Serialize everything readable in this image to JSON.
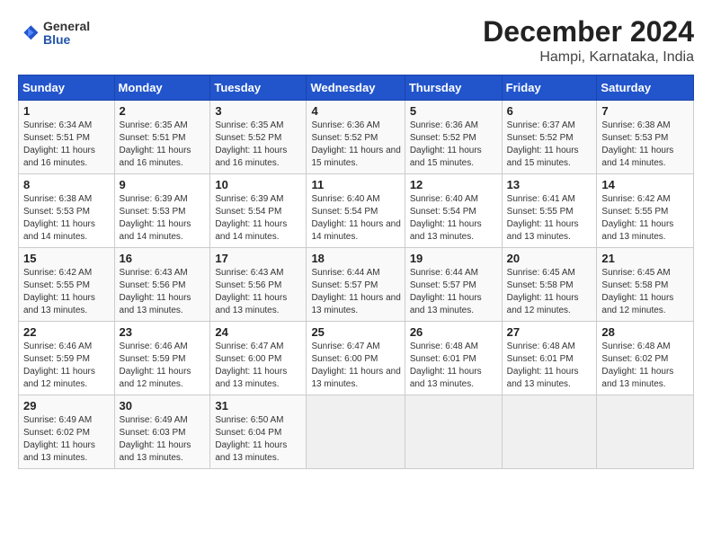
{
  "header": {
    "logo_general": "General",
    "logo_blue": "Blue",
    "month_title": "December 2024",
    "location": "Hampi, Karnataka, India"
  },
  "days_of_week": [
    "Sunday",
    "Monday",
    "Tuesday",
    "Wednesday",
    "Thursday",
    "Friday",
    "Saturday"
  ],
  "weeks": [
    [
      {
        "day": "1",
        "sunrise": "6:34 AM",
        "sunset": "5:51 PM",
        "daylight": "11 hours and 16 minutes."
      },
      {
        "day": "2",
        "sunrise": "6:35 AM",
        "sunset": "5:51 PM",
        "daylight": "11 hours and 16 minutes."
      },
      {
        "day": "3",
        "sunrise": "6:35 AM",
        "sunset": "5:52 PM",
        "daylight": "11 hours and 16 minutes."
      },
      {
        "day": "4",
        "sunrise": "6:36 AM",
        "sunset": "5:52 PM",
        "daylight": "11 hours and 15 minutes."
      },
      {
        "day": "5",
        "sunrise": "6:36 AM",
        "sunset": "5:52 PM",
        "daylight": "11 hours and 15 minutes."
      },
      {
        "day": "6",
        "sunrise": "6:37 AM",
        "sunset": "5:52 PM",
        "daylight": "11 hours and 15 minutes."
      },
      {
        "day": "7",
        "sunrise": "6:38 AM",
        "sunset": "5:53 PM",
        "daylight": "11 hours and 14 minutes."
      }
    ],
    [
      {
        "day": "8",
        "sunrise": "6:38 AM",
        "sunset": "5:53 PM",
        "daylight": "11 hours and 14 minutes."
      },
      {
        "day": "9",
        "sunrise": "6:39 AM",
        "sunset": "5:53 PM",
        "daylight": "11 hours and 14 minutes."
      },
      {
        "day": "10",
        "sunrise": "6:39 AM",
        "sunset": "5:54 PM",
        "daylight": "11 hours and 14 minutes."
      },
      {
        "day": "11",
        "sunrise": "6:40 AM",
        "sunset": "5:54 PM",
        "daylight": "11 hours and 14 minutes."
      },
      {
        "day": "12",
        "sunrise": "6:40 AM",
        "sunset": "5:54 PM",
        "daylight": "11 hours and 13 minutes."
      },
      {
        "day": "13",
        "sunrise": "6:41 AM",
        "sunset": "5:55 PM",
        "daylight": "11 hours and 13 minutes."
      },
      {
        "day": "14",
        "sunrise": "6:42 AM",
        "sunset": "5:55 PM",
        "daylight": "11 hours and 13 minutes."
      }
    ],
    [
      {
        "day": "15",
        "sunrise": "6:42 AM",
        "sunset": "5:55 PM",
        "daylight": "11 hours and 13 minutes."
      },
      {
        "day": "16",
        "sunrise": "6:43 AM",
        "sunset": "5:56 PM",
        "daylight": "11 hours and 13 minutes."
      },
      {
        "day": "17",
        "sunrise": "6:43 AM",
        "sunset": "5:56 PM",
        "daylight": "11 hours and 13 minutes."
      },
      {
        "day": "18",
        "sunrise": "6:44 AM",
        "sunset": "5:57 PM",
        "daylight": "11 hours and 13 minutes."
      },
      {
        "day": "19",
        "sunrise": "6:44 AM",
        "sunset": "5:57 PM",
        "daylight": "11 hours and 13 minutes."
      },
      {
        "day": "20",
        "sunrise": "6:45 AM",
        "sunset": "5:58 PM",
        "daylight": "11 hours and 12 minutes."
      },
      {
        "day": "21",
        "sunrise": "6:45 AM",
        "sunset": "5:58 PM",
        "daylight": "11 hours and 12 minutes."
      }
    ],
    [
      {
        "day": "22",
        "sunrise": "6:46 AM",
        "sunset": "5:59 PM",
        "daylight": "11 hours and 12 minutes."
      },
      {
        "day": "23",
        "sunrise": "6:46 AM",
        "sunset": "5:59 PM",
        "daylight": "11 hours and 12 minutes."
      },
      {
        "day": "24",
        "sunrise": "6:47 AM",
        "sunset": "6:00 PM",
        "daylight": "11 hours and 13 minutes."
      },
      {
        "day": "25",
        "sunrise": "6:47 AM",
        "sunset": "6:00 PM",
        "daylight": "11 hours and 13 minutes."
      },
      {
        "day": "26",
        "sunrise": "6:48 AM",
        "sunset": "6:01 PM",
        "daylight": "11 hours and 13 minutes."
      },
      {
        "day": "27",
        "sunrise": "6:48 AM",
        "sunset": "6:01 PM",
        "daylight": "11 hours and 13 minutes."
      },
      {
        "day": "28",
        "sunrise": "6:48 AM",
        "sunset": "6:02 PM",
        "daylight": "11 hours and 13 minutes."
      }
    ],
    [
      {
        "day": "29",
        "sunrise": "6:49 AM",
        "sunset": "6:02 PM",
        "daylight": "11 hours and 13 minutes."
      },
      {
        "day": "30",
        "sunrise": "6:49 AM",
        "sunset": "6:03 PM",
        "daylight": "11 hours and 13 minutes."
      },
      {
        "day": "31",
        "sunrise": "6:50 AM",
        "sunset": "6:04 PM",
        "daylight": "11 hours and 13 minutes."
      },
      null,
      null,
      null,
      null
    ]
  ]
}
